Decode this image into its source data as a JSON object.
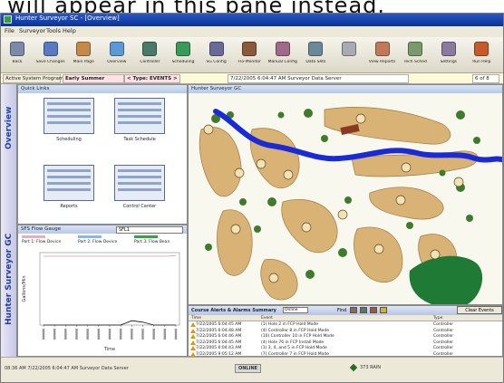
{
  "caption": "will appear in this pane instead.",
  "window": {
    "title": "Hunter Surveyor SC - [Overview]"
  },
  "menu": [
    "File",
    "Surveyor",
    "Tools",
    "Help"
  ],
  "toolbar": [
    {
      "label": "Back",
      "icon": "back-arrow-icon",
      "color": "#7a8aa8"
    },
    {
      "label": "Save Changes",
      "icon": "save-icon",
      "color": "#5a7ac4"
    },
    {
      "label": "Main Page",
      "icon": "home-icon",
      "color": "#c48a4a"
    },
    {
      "label": "Overview",
      "icon": "overview-icon",
      "color": "#5a9ad4"
    },
    {
      "label": "Controller",
      "icon": "controller-icon",
      "color": "#4a7a6a"
    },
    {
      "label": "Scheduling",
      "icon": "clock-icon",
      "color": "#3a9a5a"
    },
    {
      "label": "SG Config",
      "icon": "monitor-icon",
      "color": "#6a6a9a"
    },
    {
      "label": "Flo-Monitor",
      "icon": "flow-icon",
      "color": "#8a5a3a"
    },
    {
      "label": "Manual Config",
      "icon": "printer-icon",
      "color": "#a06a8a"
    },
    {
      "label": "Data Sets",
      "icon": "data-sets-icon",
      "color": "#6a8a9a"
    },
    {
      "label": "",
      "icon": "pointer-icon",
      "color": "#aaaab4"
    },
    {
      "label": "View Reports",
      "icon": "reports-icon",
      "color": "#c07a5a"
    },
    {
      "label": "Tech Sched",
      "icon": "tech-icon",
      "color": "#7a9a6a"
    },
    {
      "label": "Settings",
      "icon": "settings-icon",
      "color": "#8a7aa0"
    },
    {
      "label": "Run Help",
      "icon": "help-icon",
      "color": "#c65a2a"
    }
  ],
  "statusbar": {
    "program_label": "Active System Program",
    "program_value": "Early Summer",
    "type_label": "< Type: EVENTS >",
    "datetime": "7/22/2005 6:04:47 AM  Surveyor Data Server",
    "right": "6 of 8"
  },
  "lefttabs": {
    "overview": "Overview",
    "product": "Hunter Surveyor GC"
  },
  "quicklinks": {
    "title": "Quick Links",
    "items": [
      {
        "label": "Scheduling"
      },
      {
        "label": "Task Schedule"
      },
      {
        "label": "Reports"
      },
      {
        "label": "Control Center"
      }
    ]
  },
  "flow": {
    "title": "SFS Flow Gauge",
    "select_value": "SFL1",
    "legend": [
      {
        "label": "Part 1: Flow Device",
        "color": "#e0b0c4"
      },
      {
        "label": "Part 2: Flow Device",
        "color": "#8ab8e0"
      },
      {
        "label": "Part 3: Flow Bean",
        "color": "#3aa04a"
      }
    ]
  },
  "map": {
    "title": "Hunter Surveyor GC"
  },
  "events": {
    "title": "Course Alerts & Alarms Summary",
    "filter": "Online",
    "find": "Find",
    "clear_label": "Clear Events",
    "columns": [
      "Time",
      "Event",
      "Type"
    ],
    "rows": [
      {
        "time": "7/22/2005 6:04:45 AM",
        "event": "(1) Hole 2 in FCP Hold Mode",
        "type": "Controller"
      },
      {
        "time": "7/22/2005 6:04:48 AM",
        "event": "(4) Controller 8 in FCP Hold Mode",
        "type": "Controller"
      },
      {
        "time": "7/22/2005 6:04:46 AM",
        "event": "(10) Controller 10 in FCP Hold Mode",
        "type": "Controller"
      },
      {
        "time": "7/22/2005 6:04:45 AM",
        "event": "(4) Hole 76 in FCP Install Mode",
        "type": "Controller"
      },
      {
        "time": "7/22/2005 6:04:43 AM",
        "event": "(1) 3, 4, and 5 in FCP Hold Mode",
        "type": "Controller"
      },
      {
        "time": "7/22/2005 9:05:12 AM",
        "event": "(7) Controller 7 in FCP Hold Mode",
        "type": "Controller"
      }
    ]
  },
  "footer": {
    "left": "08:36 AM  7/22/2005 6:04:47 AM  Surveyor Data Server",
    "center": "ONLINE",
    "right": "373 RAIN"
  },
  "chart_data": {
    "type": "line",
    "title": "",
    "xlabel": "Time",
    "ylabel": "Gallons/Min",
    "ylim": [
      0,
      100
    ],
    "series": [
      {
        "name": "Part 1: Flow Device",
        "color": "#e0b0c4",
        "y": [
          95,
          95,
          95,
          95,
          95,
          95,
          95,
          95,
          95,
          95,
          95,
          95,
          96
        ]
      },
      {
        "name": "Part 3: Flow Bean",
        "color": "#111111",
        "y": [
          0,
          0,
          0,
          0,
          0,
          0,
          0,
          0,
          6,
          4,
          0,
          0,
          0
        ]
      }
    ]
  }
}
